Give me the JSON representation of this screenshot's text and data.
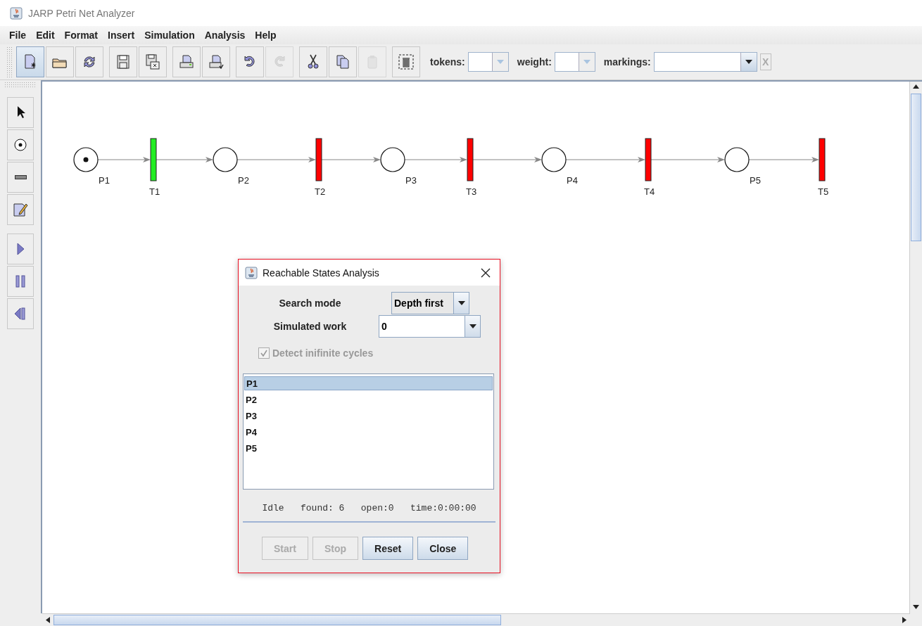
{
  "window": {
    "title": "JARP Petri Net Analyzer"
  },
  "menu": [
    {
      "label": "File"
    },
    {
      "label": "Edit"
    },
    {
      "label": "Format"
    },
    {
      "label": "Insert"
    },
    {
      "label": "Simulation"
    },
    {
      "label": "Analysis"
    },
    {
      "label": "Help"
    }
  ],
  "toolbar": {
    "buttons": [
      {
        "selected": true,
        "disabled": false
      },
      {
        "selected": false,
        "disabled": false
      },
      {
        "selected": false,
        "disabled": false
      },
      {
        "selected": false,
        "disabled": false
      },
      {
        "selected": false,
        "disabled": false
      },
      {
        "selected": false,
        "disabled": false
      },
      {
        "selected": false,
        "disabled": false
      },
      {
        "selected": false,
        "disabled": false
      },
      {
        "selected": false,
        "disabled": true
      },
      {
        "selected": false,
        "disabled": false
      },
      {
        "selected": false,
        "disabled": false
      },
      {
        "selected": false,
        "disabled": true
      },
      {
        "selected": false,
        "disabled": false
      }
    ],
    "fields": [
      {
        "label": "tokens:",
        "kind": "small"
      },
      {
        "label": "weight:",
        "kind": "small"
      },
      {
        "label": "markings:",
        "kind": "wide"
      }
    ],
    "clear_button": {
      "label": "X",
      "disabled": true
    }
  },
  "tools": [
    {
      "selected": false
    },
    {
      "selected": false
    },
    {
      "selected": false
    },
    {
      "selected": false
    },
    {
      "selected": false
    },
    {
      "selected": false
    },
    {
      "selected": false
    }
  ],
  "net": {
    "places": [
      {
        "label": "P1",
        "marked": true
      },
      {
        "label": "P2",
        "marked": false
      },
      {
        "label": "P3",
        "marked": false
      },
      {
        "label": "P4",
        "marked": false
      },
      {
        "label": "P5",
        "marked": false
      }
    ],
    "transitions": [
      {
        "label": "T1",
        "enabled": true
      },
      {
        "label": "T2",
        "enabled": false
      },
      {
        "label": "T3",
        "enabled": false
      },
      {
        "label": "T4",
        "enabled": false
      },
      {
        "label": "T5",
        "enabled": false
      }
    ]
  },
  "dialog": {
    "title": "Reachable States Analysis",
    "search_mode": {
      "label": "Search mode",
      "value": "Depth first"
    },
    "simulated_work": {
      "label": "Simulated work",
      "value": "0"
    },
    "checkbox": {
      "label": "Detect inifinite cycles",
      "checked": true,
      "disabled": true
    },
    "list": [
      {
        "label": "P1",
        "selected": true
      },
      {
        "label": "P2",
        "selected": false
      },
      {
        "label": "P3",
        "selected": false
      },
      {
        "label": "P4",
        "selected": false
      },
      {
        "label": "P5",
        "selected": false
      }
    ],
    "status": "Idle   found: 6   open:0   time:0:00:00",
    "buttons": [
      {
        "label": "Start",
        "disabled": true
      },
      {
        "label": "Stop",
        "disabled": true
      },
      {
        "label": "Reset",
        "disabled": false
      },
      {
        "label": "Close",
        "disabled": false
      }
    ]
  }
}
